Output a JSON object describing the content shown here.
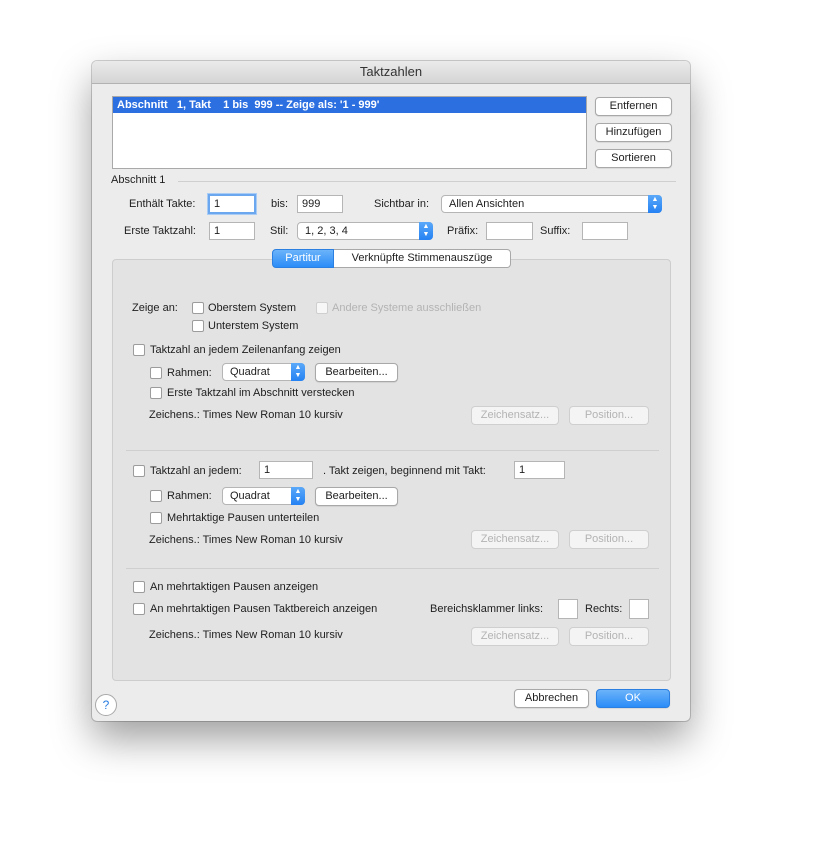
{
  "window": {
    "title": "Taktzahlen"
  },
  "list": {
    "rows": [
      "Abschnitt   1, Takt    1 bis  999 -- Zeige als: '1 - 999'"
    ]
  },
  "side_buttons": {
    "remove": "Entfernen",
    "add": "Hinzufügen",
    "sort": "Sortieren"
  },
  "section": {
    "heading": "Abschnitt 1",
    "contains_label": "Enthält Takte:",
    "contains_value": "1",
    "to_label": "bis:",
    "to_value": "999",
    "visible_label": "Sichtbar in:",
    "visible_value": "Allen Ansichten",
    "first_label": "Erste Taktzahl:",
    "first_value": "1",
    "style_label": "Stil:",
    "style_value": "1, 2, 3, 4",
    "prefix_label": "Präfix:",
    "prefix_value": "",
    "suffix_label": "Suffix:",
    "suffix_value": ""
  },
  "tabs": {
    "score": "Partitur",
    "parts": "Verknüpfte Stimmenauszüge"
  },
  "show_on": {
    "label": "Zeige an:",
    "top_staff": "Oberstem System",
    "exclude_other": "Andere Systeme ausschließen",
    "bottom_staff": "Unterstem System"
  },
  "group1": {
    "main": "Taktzahl an jedem Zeilenanfang zeigen",
    "frame_label": "Rahmen:",
    "frame_value": "Quadrat",
    "edit": "Bearbeiten...",
    "hide_first": "Erste Taktzahl im Abschnitt verstecken",
    "font": "Zeichens.: Times New Roman 10  kursiv",
    "font_btn": "Zeichensatz...",
    "pos_btn": "Position..."
  },
  "group2": {
    "main": "Taktzahl an jedem:",
    "every_value": "1",
    "mid": ". Takt zeigen, beginnend mit Takt:",
    "start_value": "1",
    "frame_label": "Rahmen:",
    "frame_value": "Quadrat",
    "edit": "Bearbeiten...",
    "split": "Mehrtaktige Pausen unterteilen",
    "font": "Zeichens.: Times New Roman 10  kursiv",
    "font_btn": "Zeichensatz...",
    "pos_btn": "Position..."
  },
  "group3": {
    "show_rests": "An mehrtaktigen Pausen anzeigen",
    "show_range": "An mehrtaktigen Pausen Taktbereich anzeigen",
    "bracket_left": "Bereichsklammer links:",
    "bracket_left_value": "",
    "bracket_right": "Rechts:",
    "bracket_right_value": "",
    "font": "Zeichens.: Times New Roman 10  kursiv",
    "font_btn": "Zeichensatz...",
    "pos_btn": "Position..."
  },
  "footer": {
    "help": "?",
    "cancel": "Abbrechen",
    "ok": "OK"
  },
  "colors": {
    "accent": "#2a8cf7",
    "selection": "#2c6fe0"
  },
  "icons": {
    "help": "question-mark-icon",
    "select": "updown-chevron-icon"
  }
}
